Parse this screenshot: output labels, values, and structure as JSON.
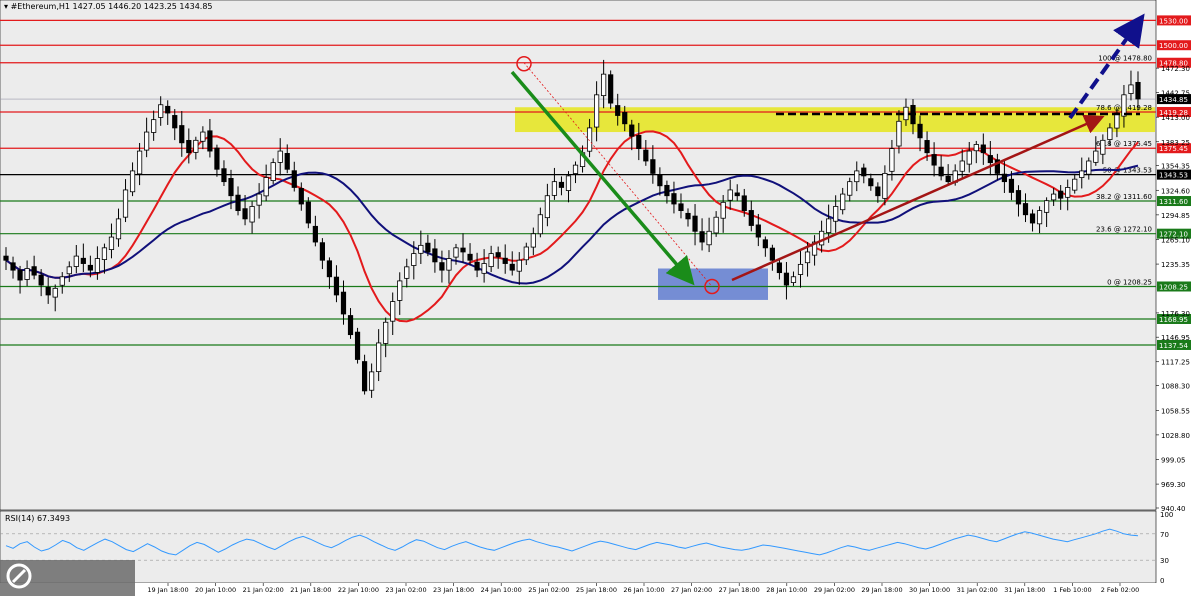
{
  "header": {
    "symbol_label": "#Ethereum,H1",
    "ohlc_text": "1427.05 1446.20 1423.25 1434.85"
  },
  "rsi": {
    "label": "RSI(14) 67.3493",
    "levels": [
      "100",
      "70",
      "30",
      "0"
    ],
    "values": [
      52,
      48,
      55,
      58,
      50,
      44,
      47,
      53,
      60,
      56,
      49,
      45,
      51,
      57,
      62,
      58,
      52,
      46,
      43,
      49,
      55,
      50,
      44,
      40,
      38,
      45,
      52,
      57,
      54,
      48,
      42,
      47,
      53,
      58,
      62,
      60,
      55,
      50,
      46,
      52,
      58,
      63,
      66,
      62,
      57,
      52,
      49,
      54,
      60,
      65,
      68,
      64,
      58,
      53,
      48,
      45,
      50,
      56,
      61,
      59,
      54,
      49,
      46,
      51,
      55,
      58,
      54,
      50,
      47,
      45,
      49,
      53,
      57,
      60,
      62,
      58,
      55,
      52,
      50,
      47,
      44,
      48,
      52,
      56,
      59,
      57,
      54,
      51,
      48,
      46,
      50,
      54,
      57,
      55,
      53,
      50,
      48,
      51,
      54,
      56,
      53,
      50,
      48,
      46,
      45,
      47,
      50,
      53,
      52,
      50,
      48,
      46,
      44,
      42,
      40,
      38,
      41,
      45,
      49,
      52,
      50,
      47,
      45,
      48,
      51,
      54,
      57,
      55,
      52,
      49,
      47,
      50,
      54,
      58,
      62,
      65,
      68,
      66,
      63,
      60,
      58,
      62,
      66,
      70,
      73,
      71,
      68,
      65,
      62,
      60,
      58,
      61,
      64,
      67,
      70,
      74,
      77,
      74,
      70,
      68,
      67
    ]
  },
  "colors": {
    "candle": "#000000",
    "ma_fast": "#e31a1c",
    "ma_slow": "#10107a",
    "resistance": "#e31a1c",
    "support": "#1a7a1a",
    "pivot": "#000000",
    "yellow_zone": "#e6e600",
    "blue_zone": "#4d6ecc",
    "green_arrow": "#1a8c1a",
    "red_arrow": "#a31515",
    "blue_arrow": "#10108c",
    "rsi_line": "#3399ff"
  },
  "chart_data": {
    "type": "candlestick",
    "ylim": [
      940.4,
      1545
    ],
    "price_ticks": [
      "1472.30",
      "1442.75",
      "1413.00",
      "1383.25",
      "1354.35",
      "1324.60",
      "1294.85",
      "1265.10",
      "1235.35",
      "1176.30",
      "1146.95",
      "1117.25",
      "1088.30",
      "1058.55",
      "1028.80",
      "999.05",
      "969.30",
      "940.40"
    ],
    "x_labels": [
      "19 Jan 18:00",
      "20 Jan 10:00",
      "21 Jan 02:00",
      "21 Jan 18:00",
      "22 Jan 10:00",
      "23 Jan 02:00",
      "23 Jan 18:00",
      "24 Jan 10:00",
      "25 Jan 02:00",
      "25 Jan 18:00",
      "26 Jan 10:00",
      "27 Jan 02:00",
      "27 Jan 18:00",
      "28 Jan 10:00",
      "29 Jan 02:00",
      "29 Jan 18:00",
      "30 Jan 10:00",
      "31 Jan 02:00",
      "31 Jan 18:00",
      "1 Feb 10:00",
      "2 Feb 02:00"
    ],
    "horizontal_levels": [
      {
        "label": "1530.00",
        "value": 1530.0,
        "kind": "resistance"
      },
      {
        "label": "1500.00",
        "value": 1500.0,
        "kind": "resistance"
      },
      {
        "label": "1478.80",
        "value": 1478.8,
        "kind": "resistance",
        "fib": "100 @ 1478.80"
      },
      {
        "label": "1419.28",
        "value": 1419.28,
        "kind": "resistance",
        "fib": "78.6 @ 1419.28"
      },
      {
        "label": "1375.45",
        "value": 1375.45,
        "kind": "resistance",
        "fib": "61.8 @ 1375.45"
      },
      {
        "label": "1343.53",
        "value": 1343.53,
        "kind": "pivot",
        "fib": "50 @ 1343.53"
      },
      {
        "label": "1311.60",
        "value": 1311.6,
        "kind": "support",
        "fib": "38.2 @ 1311.60"
      },
      {
        "label": "1272.10",
        "value": 1272.1,
        "kind": "support",
        "fib": "23.6 @ 1272.10"
      },
      {
        "label": "1208.25",
        "value": 1208.25,
        "kind": "support",
        "fib": "0 @ 1208.25"
      },
      {
        "label": "1168.95",
        "value": 1168.95,
        "kind": "support"
      },
      {
        "label": "1137.54",
        "value": 1137.54,
        "kind": "support"
      }
    ],
    "current_price": {
      "label": "1434.85",
      "value": 1434.85
    },
    "close_series": [
      1240,
      1228,
      1216,
      1230,
      1222,
      1210,
      1198,
      1206,
      1220,
      1232,
      1245,
      1236,
      1228,
      1242,
      1255,
      1268,
      1290,
      1325,
      1348,
      1372,
      1395,
      1410,
      1428,
      1418,
      1400,
      1382,
      1370,
      1385,
      1395,
      1372,
      1350,
      1335,
      1318,
      1300,
      1290,
      1305,
      1320,
      1340,
      1358,
      1372,
      1350,
      1328,
      1308,
      1285,
      1262,
      1240,
      1220,
      1198,
      1175,
      1150,
      1120,
      1082,
      1105,
      1140,
      1165,
      1190,
      1215,
      1232,
      1248,
      1258,
      1250,
      1238,
      1228,
      1242,
      1255,
      1250,
      1240,
      1228,
      1236,
      1248,
      1244,
      1236,
      1228,
      1240,
      1256,
      1272,
      1295,
      1318,
      1335,
      1328,
      1342,
      1355,
      1370,
      1400,
      1440,
      1465,
      1430,
      1415,
      1405,
      1390,
      1375,
      1360,
      1345,
      1330,
      1318,
      1308,
      1300,
      1290,
      1275,
      1262,
      1275,
      1292,
      1310,
      1325,
      1318,
      1300,
      1282,
      1268,
      1255,
      1240,
      1225,
      1210,
      1220,
      1235,
      1250,
      1262,
      1275,
      1290,
      1305,
      1320,
      1335,
      1348,
      1342,
      1330,
      1318,
      1345,
      1375,
      1408,
      1425,
      1405,
      1388,
      1370,
      1355,
      1342,
      1335,
      1348,
      1360,
      1372,
      1380,
      1370,
      1358,
      1345,
      1335,
      1322,
      1308,
      1295,
      1285,
      1300,
      1312,
      1320,
      1315,
      1328,
      1338,
      1348,
      1360,
      1372,
      1385,
      1400,
      1418,
      1440,
      1452,
      1435
    ]
  }
}
